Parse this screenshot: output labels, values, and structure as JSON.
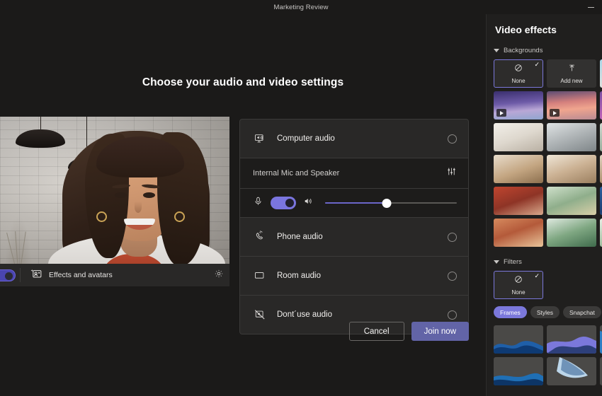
{
  "window": {
    "title": "Marketing Review",
    "minimize_label": "Minimize"
  },
  "main": {
    "heading": "Choose your audio and video settings",
    "preview": {
      "effects_label": "Effects and avatars",
      "effects_icon": "person-sparkle-icon",
      "settings_icon": "gear-icon",
      "camera_toggle_icon": "camera-toggle",
      "camera_toggle_on": true
    },
    "audio_options": [
      {
        "label": "Computer audio",
        "icon": "monitor-speaker-icon",
        "selected": false
      },
      {
        "label": "Phone audio",
        "icon": "phone-ring-icon",
        "selected": false
      },
      {
        "label": "Room audio",
        "icon": "monitor-icon",
        "selected": false
      },
      {
        "label": "Dont´use audio",
        "icon": "speaker-off-icon",
        "selected": false
      }
    ],
    "device": {
      "name": "Internal Mic and Speaker",
      "settings_icon": "equalizer-icon",
      "mic_icon": "microphone-icon",
      "mic_on": true,
      "speaker_icon": "speaker-icon",
      "volume_percent": 47
    },
    "buttons": {
      "cancel": "Cancel",
      "join": "Join now"
    }
  },
  "effects_panel": {
    "title": "Video effects",
    "backgrounds": {
      "label": "Backgrounds",
      "expanded": true,
      "none_label": "None",
      "none_icon": "no-effect-icon",
      "none_selected": true,
      "add_new_label": "Add new",
      "add_new_icon": "upload-arrow-icon"
    },
    "filters": {
      "label": "Filters",
      "expanded": true,
      "none_label": "None",
      "none_icon": "no-effect-icon",
      "none_selected": true,
      "tabs": [
        {
          "label": "Frames",
          "active": true
        },
        {
          "label": "Styles",
          "active": false
        },
        {
          "label": "Snapchat",
          "active": false
        }
      ]
    }
  },
  "colors": {
    "accent": "#6264a7",
    "accent_light": "#7b78db",
    "app_bg": "#1b1a19",
    "card_bg": "#292827",
    "panel_bg": "#201f1e"
  }
}
